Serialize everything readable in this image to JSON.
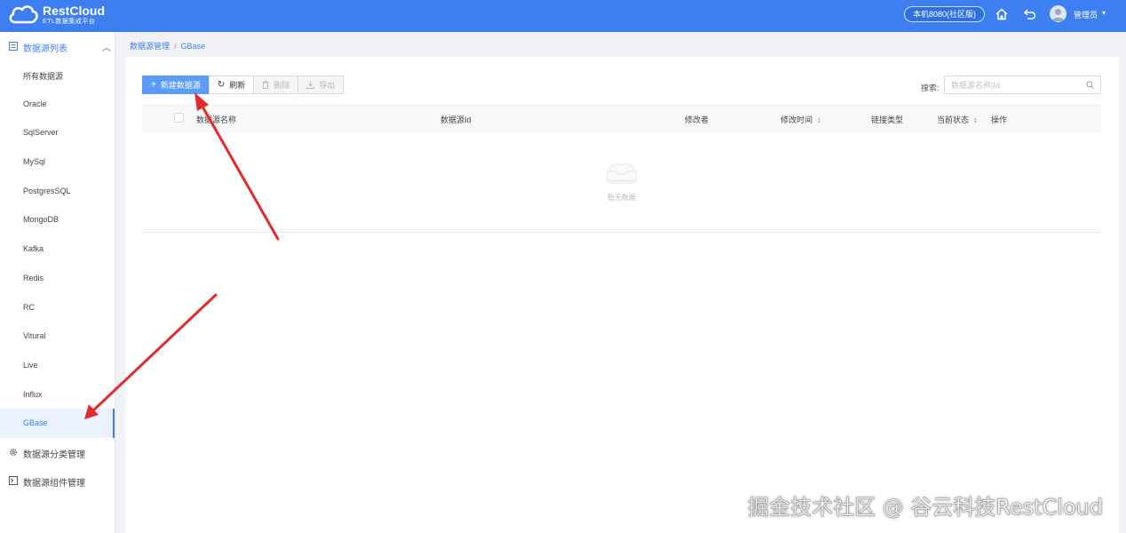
{
  "header": {
    "logo_title": "RestCloud",
    "logo_subtitle": "ETL数据集成平台",
    "host_badge": "本机8080(社区版)",
    "user_name": "管理员"
  },
  "sidebar": {
    "group_title": "数据源列表",
    "items": [
      {
        "label": "所有数据源"
      },
      {
        "label": "Oracle"
      },
      {
        "label": "SqlServer"
      },
      {
        "label": "MySql"
      },
      {
        "label": "PostgresSQL"
      },
      {
        "label": "MongoDB"
      },
      {
        "label": "Kafka"
      },
      {
        "label": "Redis"
      },
      {
        "label": "RC"
      },
      {
        "label": "Vitural"
      },
      {
        "label": "Live"
      },
      {
        "label": "Influx"
      },
      {
        "label": "GBase",
        "selected": true
      }
    ],
    "category_manage": "数据源分类管理",
    "component_manage": "数据源组件管理"
  },
  "breadcrumb": {
    "parent": "数据源管理",
    "separator": "/",
    "current": "GBase"
  },
  "toolbar": {
    "new_label": "新建数据源",
    "refresh_label": "刷新",
    "delete_label": "删除",
    "export_label": "导出"
  },
  "search": {
    "label": "搜索:",
    "placeholder": "数据源名称|Id",
    "value": ""
  },
  "table": {
    "columns": {
      "name": "数据源名称",
      "id": "数据源Id",
      "editor": "修改者",
      "edit_time": "修改时间",
      "link_type": "链接类型",
      "status": "当前状态",
      "action": "操作"
    },
    "rows": [],
    "empty_text": "暂无数据"
  },
  "watermark": "掘金技术社区 @ 谷云科技RestCloud",
  "colors": {
    "primary": "#3d7ff1",
    "primary_button": "#5b9cf8",
    "annotation_arrow": "#e32b2b"
  }
}
